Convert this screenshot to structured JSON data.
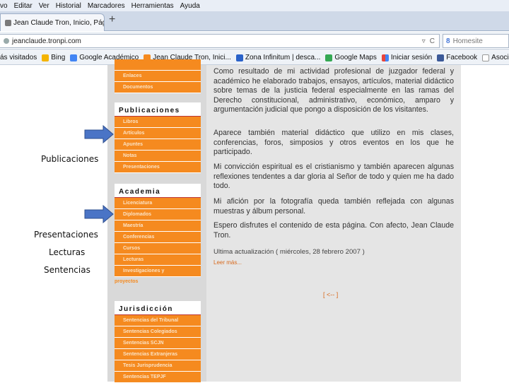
{
  "menubar": {
    "items": [
      "vo",
      "Editar",
      "Ver",
      "Historial",
      "Marcadores",
      "Herramientas",
      "Ayuda"
    ]
  },
  "tab": {
    "title": "Jean Claude Tron, Inicio, Pági...",
    "close": "×",
    "new_tab": "+"
  },
  "address": {
    "url": "jeanclaude.tronpi.com",
    "search_placeholder": "Homesite"
  },
  "bookmarks": {
    "items": [
      {
        "label": "ás visitados",
        "color": "#999999"
      },
      {
        "label": "Bing",
        "color": "#f4b400"
      },
      {
        "label": "Google Académico",
        "color": "#4285f4"
      },
      {
        "label": "Jean Claude Tron, Inici...",
        "color": "#f58a1f"
      },
      {
        "label": "Zona Infinitum | desca...",
        "color": "#2a62c9"
      },
      {
        "label": "Google Maps",
        "color": "#34a853"
      },
      {
        "label": "Iniciar sesión",
        "color": "#e8453c"
      },
      {
        "label": "Facebook",
        "color": "#3b5998"
      },
      {
        "label": "Asociación Iber",
        "color": "#ffffff"
      }
    ]
  },
  "sidebar": {
    "top_items": [
      "",
      "Enlaces",
      "Documentos"
    ],
    "publicaciones": {
      "title": "Publicaciones",
      "items": [
        "Libros",
        "Artículos",
        "Apuntes",
        "Notas",
        "Presentaciones"
      ]
    },
    "academia": {
      "title": "Academia",
      "items": [
        "Licenciatura",
        "Diplomados",
        "Maestría",
        "Conferencias",
        "Cursos",
        "Lecturas",
        "Investigaciones y"
      ],
      "overflow": "proyectos"
    },
    "jurisdiccion": {
      "title": "Jurisdicción",
      "items": [
        "Sentencias del Tribunal",
        "Sentencias Colegiados",
        "Sentencias SCJN",
        "Sentencias Extranjeras",
        "Tesis Jurisprudencia",
        "Sentencias TEPJF"
      ]
    }
  },
  "main": {
    "paragraphs": [
      "Como resultado de mi actividad profesional de juzgador federal y académico he elaborado trabajos, ensayos, artículos, material didáctico sobre temas de la justicia federal especialmente en las ramas del Derecho constitucional, administrativo, económico, amparo y argumentación judicial que pongo a disposición de los visitantes.",
      "Aparece también material didáctico que utilizo en mis clases, conferencias, foros, simposios y otros eventos en los que he participado.",
      "Mi convicción espiritual es el cristianismo y también aparecen algunas reflexiones tendentes a dar gloria al Señor de todo y quien me ha dado todo.",
      "Mi afición por la fotografía queda también reflejada con algunas muestras y álbum personal.",
      "Espero disfrutes el contenido de esta página. Con afecto, Jean Claude Tron."
    ],
    "update": "Ultima actualización ( miércoles, 28 febrero 2007 )",
    "more": "Leer más...",
    "back": "[ <-- ]"
  },
  "annotations": {
    "publicaciones": "Publicaciones",
    "presentaciones": "Presentaciones",
    "lecturas": "Lecturas",
    "sentencias": "Sentencias"
  },
  "colors": {
    "sidebar_item": "#f58a1f",
    "arrow": "#4a74c6"
  }
}
